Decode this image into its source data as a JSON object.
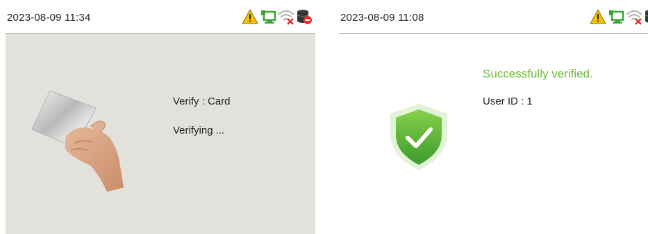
{
  "left_screen": {
    "timestamp": "2023-08-09 11:34",
    "verify_label": "Verify : Card",
    "status_label": "Verifying ...",
    "icons": [
      "warning-icon",
      "network-icon",
      "wifi-off-icon",
      "database-error-icon"
    ]
  },
  "right_screen": {
    "timestamp": "2023-08-09 11:08",
    "success_message": "Successfully verified.",
    "user_id_label": "User ID : 1",
    "icons": [
      "warning-icon",
      "network-icon",
      "wifi-off-icon",
      "database-error-icon"
    ]
  },
  "colors": {
    "success": "#6dbb3a",
    "left_background": "#e3e1db",
    "warning": "#f2c200",
    "network": "#3aa535",
    "error": "#e3312d"
  }
}
